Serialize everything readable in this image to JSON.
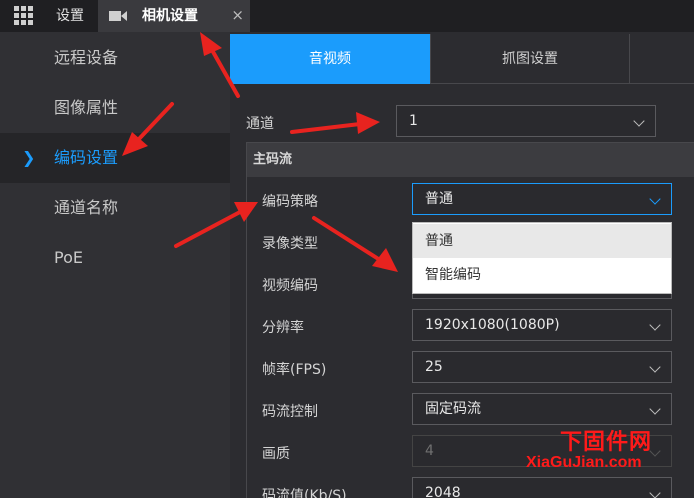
{
  "topbar": {
    "settings_tab": "设置",
    "camera_tab": "相机设置",
    "close_symbol": "×"
  },
  "sidebar": {
    "items": [
      {
        "label": "远程设备"
      },
      {
        "label": "图像属性"
      },
      {
        "label": "编码设置",
        "active": true
      },
      {
        "label": "通道名称"
      },
      {
        "label": "PoE"
      }
    ]
  },
  "subtabs": [
    {
      "label": "音视频",
      "active": true
    },
    {
      "label": "抓图设置"
    }
  ],
  "channel": {
    "label": "通道",
    "value": "1"
  },
  "main_stream": {
    "title": "主码流",
    "fields": [
      {
        "label": "编码策略",
        "value": "普通"
      },
      {
        "label": "录像类型",
        "value": ""
      },
      {
        "label": "视频编码",
        "value": ""
      },
      {
        "label": "分辨率",
        "value": "1920x1080(1080P)"
      },
      {
        "label": "帧率(FPS)",
        "value": "25"
      },
      {
        "label": "码流控制",
        "value": "固定码流"
      },
      {
        "label": "画质",
        "value": "4"
      },
      {
        "label": "码流值(Kb/S)",
        "value": "2048"
      }
    ]
  },
  "dropdown": {
    "options": [
      "普通",
      "智能编码"
    ],
    "highlighted": "普通"
  },
  "watermark": {
    "cn": "下固件网",
    "en": "XiaGuJian.com"
  },
  "colors": {
    "accent": "#1b9cfc",
    "annotation": "#e8231f"
  }
}
